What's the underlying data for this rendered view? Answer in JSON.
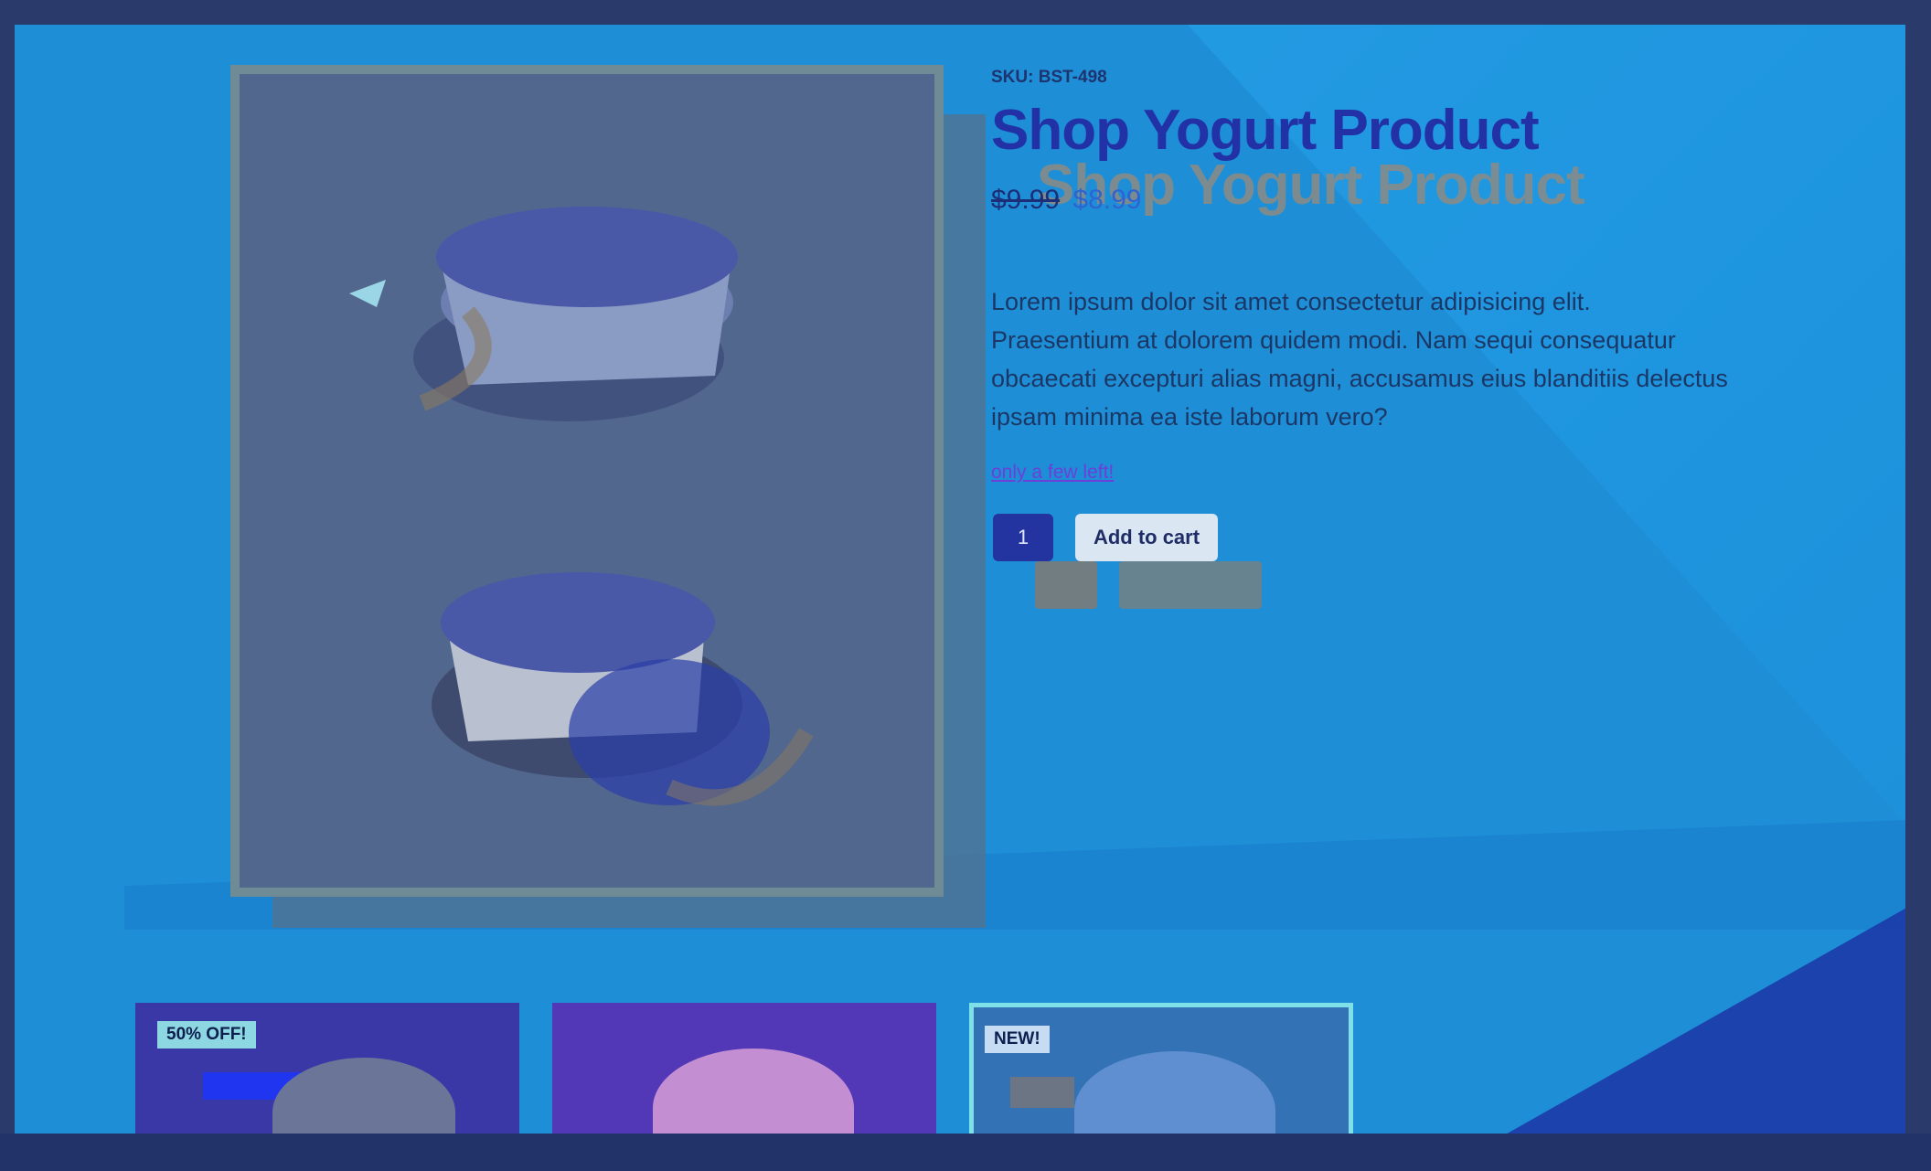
{
  "product": {
    "sku": "SKU: BST-498",
    "title": "Shop Yogurt Product",
    "price_old": "$9.99",
    "price_new": "$8.99",
    "description": "Lorem ipsum dolor sit amet consectetur adipisicing elit. Praesentium at dolorem quidem modi. Nam sequi consequatur obcaecati excepturi alias magni, accusamus eius blanditiis delectus ipsam minima ea iste laborum vero?",
    "stock_note": "only a few left!",
    "quantity": "1",
    "add_to_cart_label": "Add to cart"
  },
  "related": [
    {
      "badge": "50% OFF!"
    },
    {
      "badge": ""
    },
    {
      "badge": "NEW!"
    }
  ],
  "colors": {
    "accent": "#2231a6",
    "price_new": "#2e63d1",
    "stock_note": "#6b3fd8"
  }
}
